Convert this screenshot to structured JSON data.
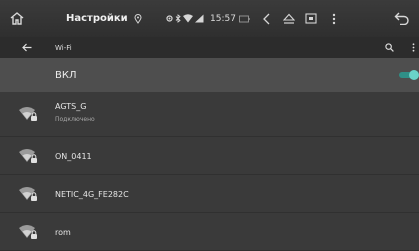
{
  "statusbar": {
    "title": "Настройки",
    "time": "15:57",
    "icons": [
      "home-icon",
      "location-icon",
      "bluetooth-icon",
      "wifi-signal-icon",
      "cell-signal-icon",
      "battery-icon",
      "volume-icon",
      "eject-icon",
      "screen-icon",
      "more-vert-icon",
      "back-icon"
    ]
  },
  "appbar": {
    "title": "Wi-Fi",
    "icons": [
      "arrow-back-icon",
      "search-icon",
      "overflow-menu-icon"
    ]
  },
  "toggle": {
    "label": "ВКЛ",
    "on": true
  },
  "networks": [
    {
      "ssid": "AGTS_G",
      "status": "Подключено"
    },
    {
      "ssid": "ON_0411"
    },
    {
      "ssid": "NETIC_4G_FE282C"
    },
    {
      "ssid": "rom"
    }
  ],
  "colors": {
    "accent": "#6ad3c8",
    "accent_track": "#2f8f87",
    "background": "#3a3a3a",
    "toggle_row": "#4e4e4e"
  }
}
